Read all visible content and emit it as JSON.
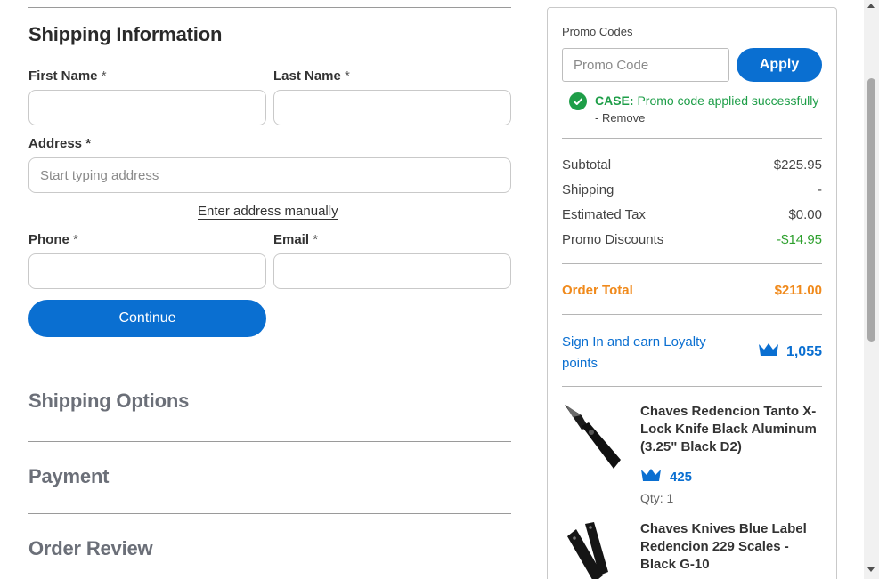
{
  "shipping_info": {
    "heading": "Shipping Information",
    "first_name": {
      "label": "First Name",
      "value": "",
      "placeholder": ""
    },
    "last_name": {
      "label": "Last Name",
      "value": "",
      "placeholder": ""
    },
    "address": {
      "label": "Address",
      "value": "",
      "placeholder": "Start typing address"
    },
    "manual_link": "Enter address manually",
    "phone": {
      "label": "Phone",
      "value": "",
      "placeholder": ""
    },
    "email": {
      "label": "Email",
      "value": "",
      "placeholder": ""
    },
    "required_mark": "*",
    "continue_label": "Continue"
  },
  "sections": {
    "shipping_options": "Shipping Options",
    "payment": "Payment",
    "order_review": "Order Review"
  },
  "summary": {
    "promo": {
      "label": "Promo Codes",
      "placeholder": "Promo Code",
      "value": "",
      "apply_label": "Apply",
      "code": "CASE:",
      "message": "Promo code applied successfully",
      "remove": "- Remove"
    },
    "rows": [
      {
        "label": "Subtotal",
        "value": "$225.95"
      },
      {
        "label": "Shipping",
        "value": "-"
      },
      {
        "label": "Estimated Tax",
        "value": "$0.00"
      },
      {
        "label": "Promo Discounts",
        "value": "-$14.95"
      }
    ],
    "total": {
      "label": "Order Total",
      "value": "$211.00"
    },
    "loyalty": {
      "link": "Sign In and earn Loyalty points",
      "points": "1,055"
    },
    "items": [
      {
        "name": "Chaves Redencion Tanto X-Lock Knife Black Aluminum (3.25\" Black D2)",
        "points": "425",
        "qty": "Qty: 1"
      },
      {
        "name": "Chaves Knives Blue Label Redencion 229 Scales - Black G-10",
        "points": "",
        "qty": ""
      }
    ]
  },
  "colors": {
    "primary": "#0a6fd1",
    "success": "#1e9e48",
    "discount": "#2ea02e",
    "total": "#f08a1c",
    "section_heading": "#6b6f78"
  },
  "icons": {
    "promo_status": "check-circle-icon",
    "loyalty": "crown-icon"
  }
}
